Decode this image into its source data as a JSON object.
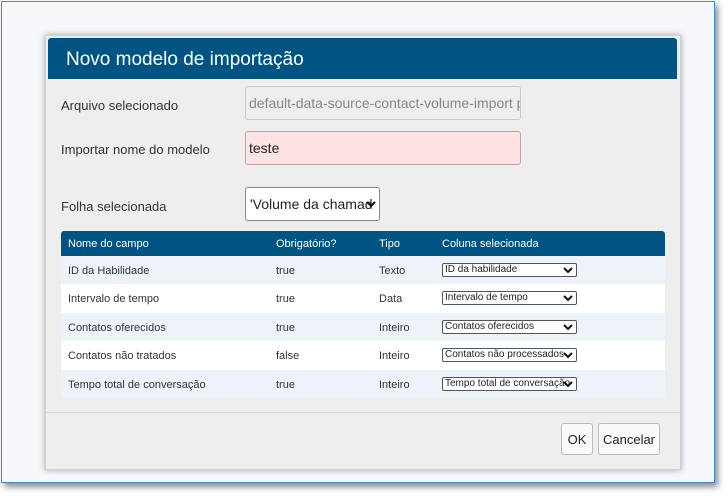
{
  "dialog": {
    "title": "Novo modelo de importação",
    "file_label": "Arquivo selecionado",
    "file_value": "default-data-source-contact-volume-import pr",
    "name_label": "Importar nome do modelo",
    "name_value": "teste",
    "sheet_label": "Folha selecionada",
    "sheet_value": "'Volume da chamad"
  },
  "table": {
    "headers": [
      "Nome do campo",
      "Obrigatório?",
      "Tipo",
      "Coluna selecionada"
    ],
    "rows": [
      {
        "field": "ID da Habilidade",
        "required": "true",
        "type": "Texto",
        "column": "ID da habilidade"
      },
      {
        "field": "Intervalo de tempo",
        "required": "true",
        "type": "Data",
        "column": "Intervalo de tempo"
      },
      {
        "field": "Contatos oferecidos",
        "required": "true",
        "type": "Inteiro",
        "column": "Contatos oferecidos"
      },
      {
        "field": "Contatos não tratados",
        "required": "false",
        "type": "Inteiro",
        "column": "Contatos não processados"
      },
      {
        "field": "Tempo total de conversação",
        "required": "true",
        "type": "Inteiro",
        "column": "Tempo total de conversação"
      }
    ]
  },
  "buttons": {
    "ok": "OK",
    "cancel": "Cancelar"
  },
  "colors": {
    "header_blue": "#005483",
    "name_field_error_bg": "#fde4e4"
  }
}
